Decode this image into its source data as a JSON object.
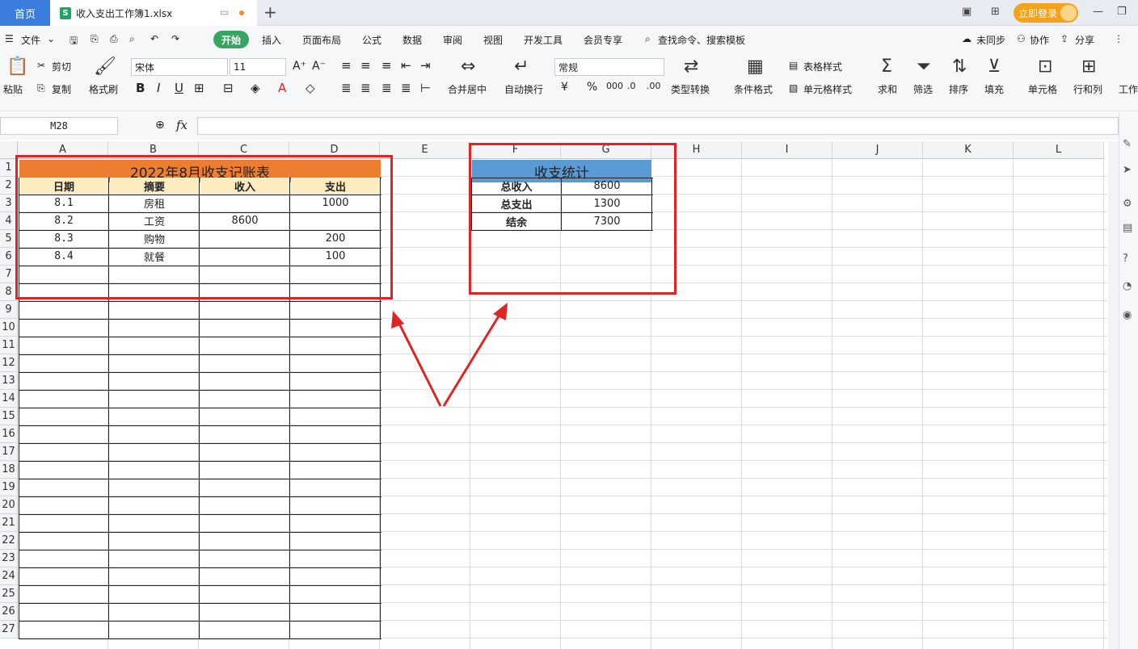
{
  "titlebar": {
    "home_tab": "首页",
    "file_name": "收入支出工作簿1.xlsx",
    "new_tab": "+",
    "login": "立即登录"
  },
  "menubar": {
    "file": "文件",
    "items": [
      "开始",
      "插入",
      "页面布局",
      "公式",
      "数据",
      "审阅",
      "视图",
      "开发工具",
      "会员专享"
    ],
    "search": "查找命令、搜索模板",
    "unsynced": "未同步",
    "collab": "协作",
    "share": "分享"
  },
  "toolbar": {
    "cut": "剪切",
    "paste": "粘贴",
    "copy": "复制",
    "format_painter": "格式刷",
    "font_name": "宋体",
    "font_size": "11",
    "merge_center": "合并居中",
    "wrap": "自动换行",
    "number_format": "常规",
    "type_convert": "类型转换",
    "cond_format": "条件格式",
    "table_style": "表格样式",
    "cell_style": "单元格样式",
    "sum": "求和",
    "filter": "筛选",
    "sort": "排序",
    "fill": "填充",
    "cell": "单元格",
    "rowcol": "行和列",
    "worksheet": "工作"
  },
  "formula": {
    "name_box": "M28",
    "fx": "fx",
    "content": ""
  },
  "columns": [
    "A",
    "B",
    "C",
    "D",
    "E",
    "F",
    "G",
    "H",
    "I",
    "J",
    "K",
    "L"
  ],
  "rows": [
    "1",
    "2",
    "3",
    "4",
    "5",
    "6",
    "7",
    "8",
    "9",
    "10",
    "11",
    "12",
    "13",
    "14",
    "15",
    "16",
    "17",
    "18",
    "19",
    "20",
    "21",
    "22",
    "23",
    "24",
    "25",
    "26",
    "27"
  ],
  "ledger": {
    "title": "2022年8月收支记账表",
    "headers": [
      "日期",
      "摘要",
      "收入",
      "支出"
    ],
    "rows": [
      [
        "8.1",
        "房租",
        "",
        "1000"
      ],
      [
        "8.2",
        "工资",
        "8600",
        ""
      ],
      [
        "8.3",
        "购物",
        "",
        "200"
      ],
      [
        "8.4",
        "就餐",
        "",
        "100"
      ]
    ]
  },
  "stats": {
    "title": "收支统计",
    "rows": [
      [
        "总收入",
        "8600"
      ],
      [
        "总支出",
        "1300"
      ],
      [
        "结余",
        "7300"
      ]
    ]
  },
  "colors": {
    "ledger_title_bg": "#ed7d31",
    "ledger_header_bg": "#fdecc0",
    "stats_title_bg": "#5b9bd5",
    "annotation": "#e02424",
    "start_button": "#36a561"
  }
}
